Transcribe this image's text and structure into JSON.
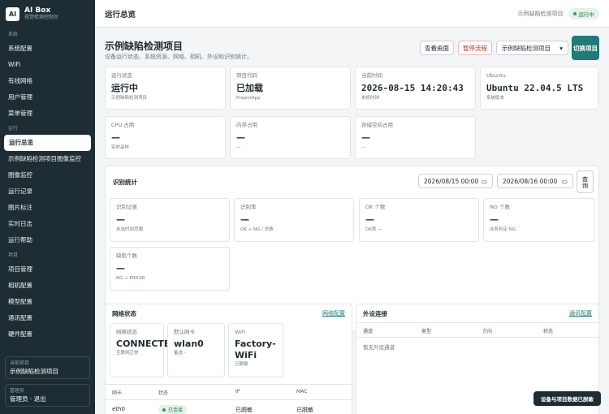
{
  "brand": {
    "logo": "AI",
    "title": "AI Box",
    "subtitle": "视觉检测控制台"
  },
  "sidebar": {
    "groups": [
      {
        "label": "系统",
        "items": [
          "系统配置",
          "WiFi",
          "有线网络",
          "用户管理",
          "菜单管理"
        ]
      },
      {
        "label": "运行",
        "items": [
          "运行总览",
          "示例缺陷检测项目图像监控",
          "图像监控",
          "运行记录",
          "图片标注",
          "实时日志",
          "运行帮助"
        ]
      },
      {
        "label": "项目",
        "items": [
          "项目管理",
          "相机配置",
          "模型配置",
          "通讯配置",
          "硬件配置"
        ]
      }
    ],
    "active_item": "运行总览",
    "current_project": {
      "label": "当前项目",
      "value": "示例缺陷检测项目"
    },
    "admin": {
      "label": "管理员",
      "value": "管理员 · 退出"
    }
  },
  "topbar": {
    "title": "运行总览",
    "project": "示例缺陷检测项目",
    "badge": "运行中",
    "badge_color": "#2a9d5f"
  },
  "header": {
    "title": "示例缺陷检测项目",
    "subtitle": "设备运行状态、系统资源、网络、相机、外设和识别统计。",
    "btn_view": "查看画面",
    "btn_stop": "暂停流程",
    "project_select": "示例缺陷检测项目",
    "btn_switch": "切换项目"
  },
  "cards_row1": [
    {
      "label": "运行状态",
      "value": "运行中",
      "hint": "示例缺陷检测项目"
    },
    {
      "label": "项目代码",
      "value": "已加载",
      "hint": "ProjectApp"
    },
    {
      "label": "当前时间",
      "value": "2026-08-15 14:20:43",
      "hint": "本机时钟"
    },
    {
      "label": "Ubuntu",
      "value": "Ubuntu 22.04.5 LTS",
      "hint": "系统版本"
    }
  ],
  "cards_row2": [
    {
      "label": "CPU 占用",
      "value": "—",
      "hint": "实时采样"
    },
    {
      "label": "内存占用",
      "value": "—",
      "hint": "—"
    },
    {
      "label": "存储空间占用",
      "value": "—",
      "hint": "—"
    }
  ],
  "stats": {
    "title": "识别统计",
    "date_from": "2026/08/15 00:00",
    "date_to": "2026/08/16 00:00",
    "query": "查询",
    "cards": [
      {
        "label": "识别记录",
        "value": "—",
        "hint": "未选时间范围"
      },
      {
        "label": "识别率",
        "value": "—",
        "hint": "OK + NG / 总数"
      },
      {
        "label": "OK 个数",
        "value": "—",
        "hint": "OK率 —"
      },
      {
        "label": "NG 个数",
        "value": "—",
        "hint": "业务判定 NG"
      },
      {
        "label": "缺陷个数",
        "value": "—",
        "hint": "NG + ERROR"
      }
    ]
  },
  "network": {
    "title": "网络状态",
    "link": "网络配置",
    "cards": [
      {
        "label": "网络状态",
        "value": "CONNECTED",
        "hint": "互联网正常"
      },
      {
        "label": "默认网卡",
        "value": "wlan0",
        "hint": "备选 -"
      },
      {
        "label": "WiFi",
        "value": "Factory-WiFi",
        "hint": "已联敏"
      }
    ],
    "columns": [
      "网卡",
      "状态",
      "IP",
      "MAC"
    ],
    "rows": [
      {
        "name": "eth0",
        "status": "已连接",
        "ip": "已脱敏",
        "mac": "已脱敏"
      }
    ]
  },
  "peripheral": {
    "title": "外设连接",
    "link": "通讯配置",
    "columns": [
      "通道",
      "类型",
      "方向",
      "状态"
    ],
    "empty": "暂无外设通道"
  },
  "toast": "设备与项目数据已脱敏"
}
